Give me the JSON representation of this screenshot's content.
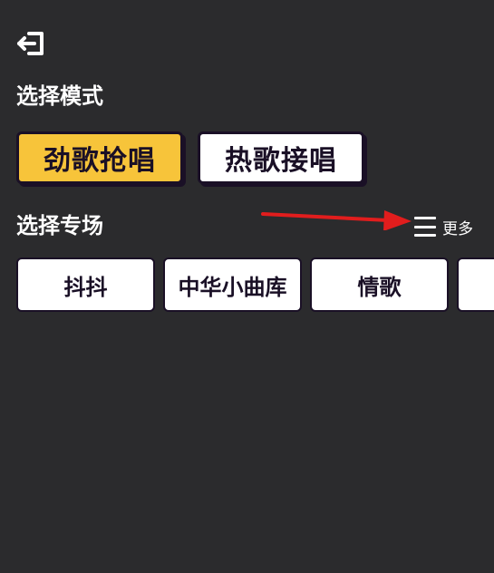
{
  "header": {
    "exit_icon": "exit-icon"
  },
  "mode_section": {
    "title": "选择模式",
    "options": [
      {
        "label": "劲歌抢唱",
        "selected": true
      },
      {
        "label": "热歌接唱",
        "selected": false
      }
    ]
  },
  "venue_section": {
    "title": "选择专场",
    "more_label": "更多",
    "more_icon": "menu-lines-icon",
    "venues": [
      "抖抖",
      "中华小曲库",
      "情歌",
      ""
    ]
  },
  "colors": {
    "background": "#2b2b2d",
    "selected": "#f7c43a",
    "card": "#ffffff",
    "border": "#1a1026",
    "arrow": "#e11d1d"
  }
}
